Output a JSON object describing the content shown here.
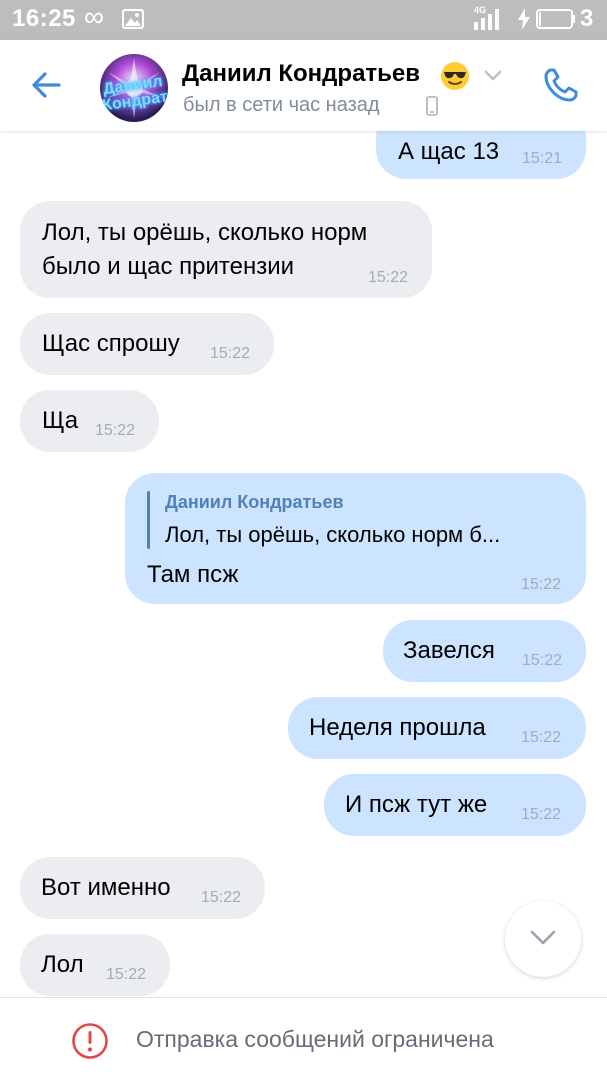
{
  "status_bar": {
    "time": "16:25",
    "network": "4G",
    "battery_text": "3"
  },
  "header": {
    "contact_name": "Даниил Кондратьев",
    "avatar_text": "Даниил Кондрат",
    "last_seen": "был в сети час назад",
    "emoji_icon": "sunglasses-emoji",
    "accent_color": "#3f8ae0"
  },
  "messages": [
    {
      "direction": "out",
      "text": "А щас 13",
      "time": "15:21"
    },
    {
      "direction": "in",
      "text_lines": [
        "Лол, ты орёшь, сколько норм",
        "было и щас притензии"
      ],
      "time": "15:22"
    },
    {
      "direction": "in",
      "text": "Щас спрошу",
      "time": "15:22"
    },
    {
      "direction": "in",
      "text": "Ща",
      "time": "15:22"
    },
    {
      "direction": "out",
      "reply_author": "Даниил Кондратьев",
      "reply_text": "Лол, ты орёшь, сколько норм б...",
      "text": "Там псж",
      "time": "15:22"
    },
    {
      "direction": "out",
      "text": "Завелся",
      "time": "15:22"
    },
    {
      "direction": "out",
      "text": "Неделя прошла",
      "time": "15:22"
    },
    {
      "direction": "out",
      "text": "И псж тут же",
      "time": "15:22"
    },
    {
      "direction": "in",
      "text": "Вот именно",
      "time": "15:22"
    },
    {
      "direction": "in",
      "text": "Лол",
      "time": "15:22"
    }
  ],
  "footer": {
    "restriction_text": "Отправка сообщений ограничена",
    "warning_color": "#e64646"
  },
  "colors": {
    "incoming_bubble": "#ebedf0",
    "outgoing_bubble": "#cce4ff",
    "status_bar": "#bdbdbd"
  }
}
